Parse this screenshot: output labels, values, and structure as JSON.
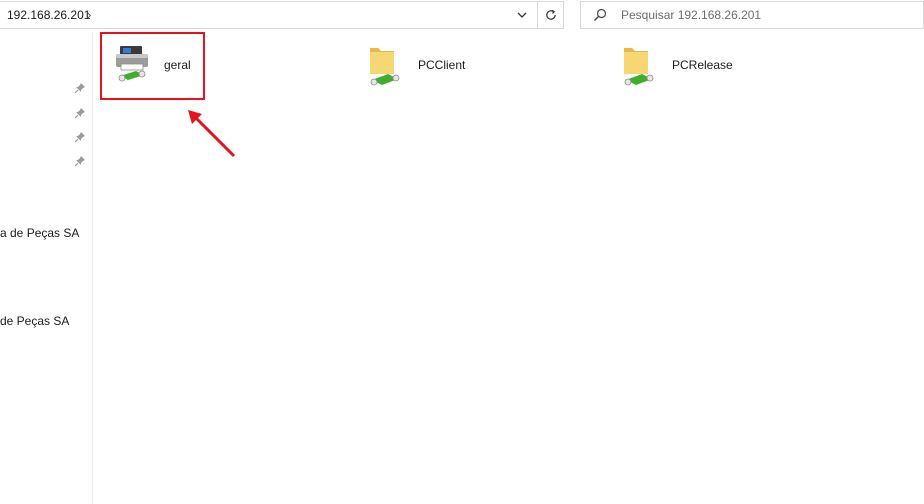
{
  "address_bar": {
    "path": "192.168.26.201",
    "separator": "›",
    "dropdown_icon": "chevron-down-icon",
    "refresh_icon": "refresh-icon"
  },
  "search": {
    "placeholder": "Pesquisar 192.168.26.201",
    "icon": "search-icon"
  },
  "nav_pane": {
    "pins": [
      "pin-icon",
      "pin-icon",
      "pin-icon",
      "pin-icon"
    ],
    "items": [
      {
        "label": "a de Peças SA"
      },
      {
        "label": "de Peças SA"
      }
    ]
  },
  "items": [
    {
      "name": "geral",
      "icon": "shared-printer-icon"
    },
    {
      "name": "PCClient",
      "icon": "shared-folder-icon"
    },
    {
      "name": "PCRelease",
      "icon": "shared-folder-icon"
    }
  ],
  "annotation": {
    "highlight_color": "#e8121c"
  }
}
